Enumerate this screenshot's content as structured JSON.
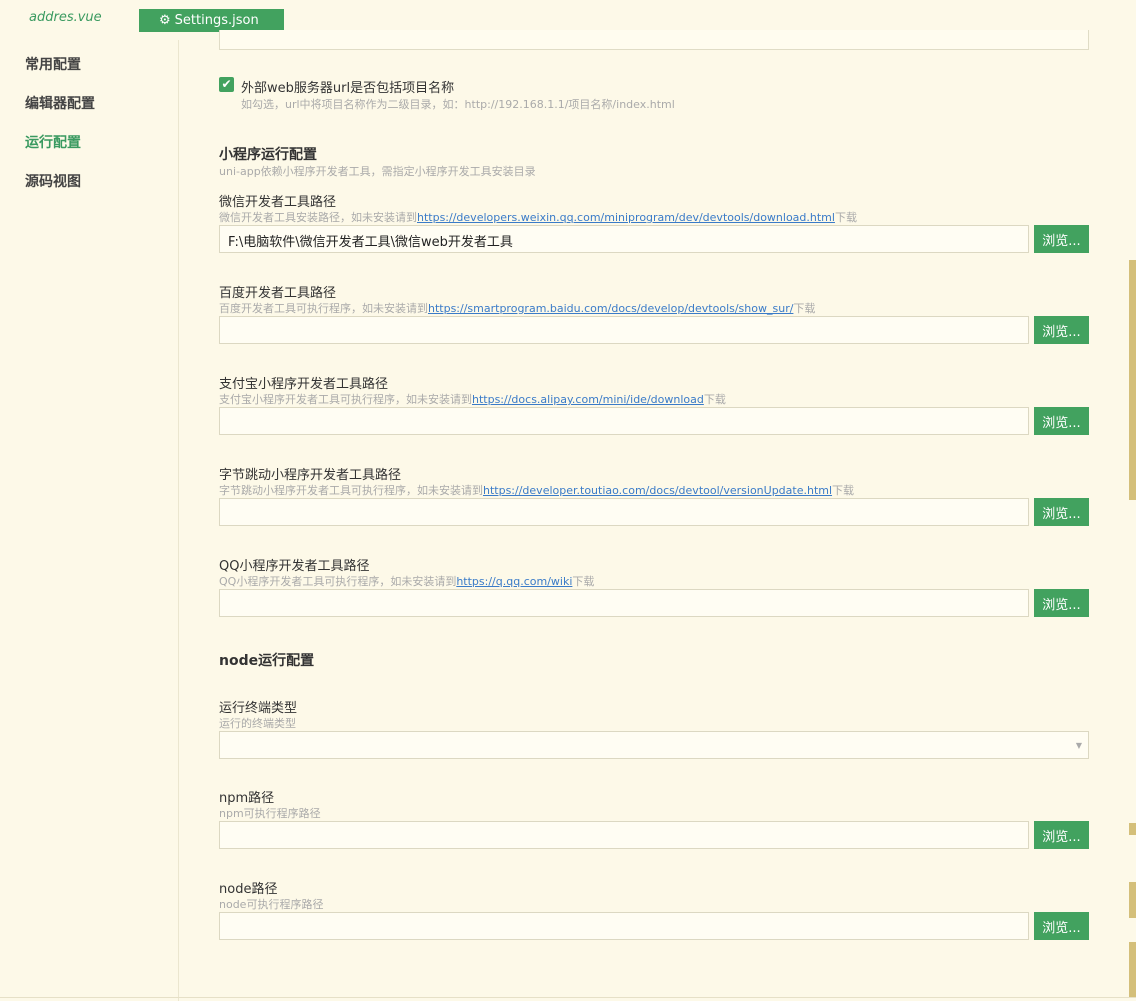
{
  "tabs": {
    "file_tab": "addres.vue",
    "settings_tab": "Settings.json"
  },
  "sidebar": {
    "items": [
      {
        "label": "常用配置"
      },
      {
        "label": "编辑器配置"
      },
      {
        "label": "运行配置",
        "active": true
      },
      {
        "label": "源码视图"
      }
    ]
  },
  "webserver": {
    "checked": true,
    "label": "外部web服务器url是否包括项目名称",
    "desc": "如勾选，url中将项目名称作为二级目录，如：http://192.168.1.1/项目名称/index.html"
  },
  "miniprogram": {
    "title": "小程序运行配置",
    "desc": "uni-app依赖小程序开发者工具，需指定小程序开发工具安装目录",
    "browse_label": "浏览...",
    "fields": [
      {
        "label": "微信开发者工具路径",
        "desc_prefix": "微信开发者工具安装路径，如未安装请到",
        "link": "https://developers.weixin.qq.com/miniprogram/dev/devtools/download.html",
        "desc_suffix": "下载",
        "value": "F:\\电脑软件\\微信开发者工具\\微信web开发者工具"
      },
      {
        "label": "百度开发者工具路径",
        "desc_prefix": "百度开发者工具可执行程序，如未安装请到",
        "link": "https://smartprogram.baidu.com/docs/develop/devtools/show_sur/",
        "desc_suffix": "下载",
        "value": ""
      },
      {
        "label": "支付宝小程序开发者工具路径",
        "desc_prefix": "支付宝小程序开发者工具可执行程序，如未安装请到",
        "link": "https://docs.alipay.com/mini/ide/download",
        "desc_suffix": "下载",
        "value": ""
      },
      {
        "label": "字节跳动小程序开发者工具路径",
        "desc_prefix": "字节跳动小程序开发者工具可执行程序，如未安装请到",
        "link": "https://developer.toutiao.com/docs/devtool/versionUpdate.html",
        "desc_suffix": "下载",
        "value": ""
      },
      {
        "label": "QQ小程序开发者工具路径",
        "desc_prefix": "QQ小程序开发者工具可执行程序，如未安装请到",
        "link": "https://q.qq.com/wiki",
        "desc_suffix": "下载",
        "value": ""
      }
    ]
  },
  "node": {
    "title": "node运行配置",
    "terminal": {
      "label": "运行终端类型",
      "desc": "运行的终端类型",
      "value": ""
    },
    "npm": {
      "label": "npm路径",
      "desc": "npm可执行程序路径",
      "value": ""
    },
    "node_path": {
      "label": "node路径",
      "desc": "node可执行程序路径",
      "value": ""
    }
  },
  "colors": {
    "accent": "#42a25f",
    "background": "#fdf9e8",
    "link": "#3a7bc8"
  }
}
